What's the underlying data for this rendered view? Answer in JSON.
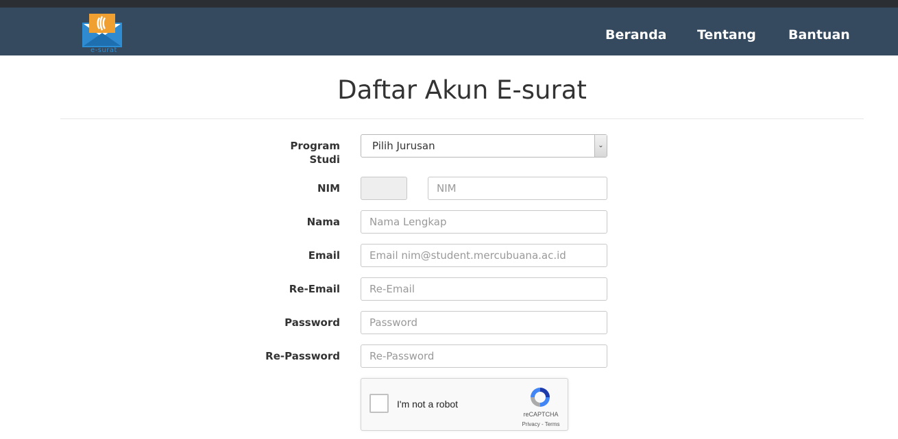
{
  "header": {
    "logo_text": "e-surat",
    "nav": [
      {
        "label": "Beranda"
      },
      {
        "label": "Tentang"
      },
      {
        "label": "Bantuan"
      }
    ]
  },
  "page": {
    "title": "Daftar Akun E-surat"
  },
  "form": {
    "program_studi": {
      "label_line1": "Program",
      "label_line2": "Studi",
      "value": "Pilih Jurusan"
    },
    "nim": {
      "label": "NIM",
      "placeholder": "NIM"
    },
    "nama": {
      "label": "Nama",
      "placeholder": "Nama Lengkap"
    },
    "email": {
      "label": "Email",
      "placeholder": "Email nim@student.mercubuana.ac.id"
    },
    "re_email": {
      "label": "Re-Email",
      "placeholder": "Re-Email"
    },
    "password": {
      "label": "Password",
      "placeholder": "Password"
    },
    "re_password": {
      "label": "Re-Password",
      "placeholder": "Re-Password"
    }
  },
  "recaptcha": {
    "label": "I'm not a robot",
    "brand": "reCAPTCHA",
    "terms": "Privacy - Terms"
  },
  "colors": {
    "navbar": "#354a5f",
    "topstrip": "#2b2f34",
    "logo_orange": "#f0a030",
    "logo_blue": "#2c8fd6"
  }
}
